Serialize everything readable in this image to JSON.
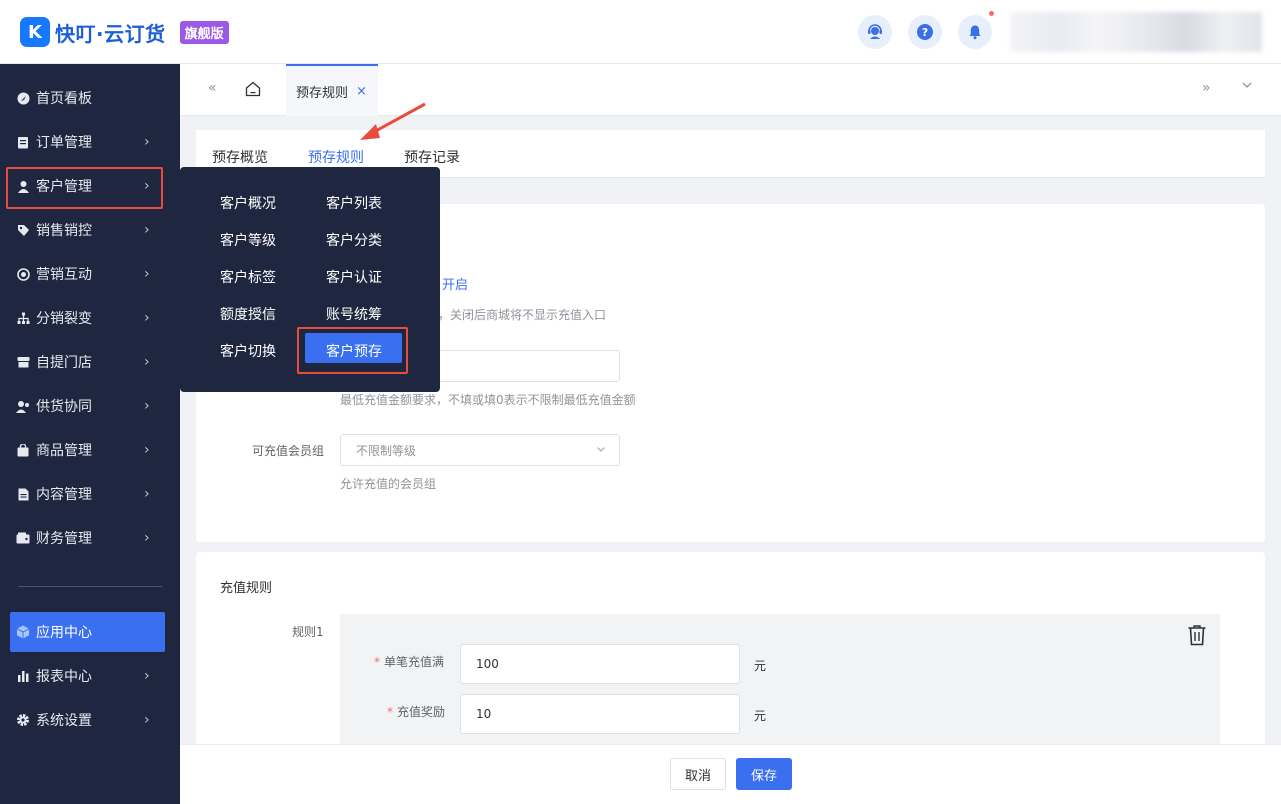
{
  "header": {
    "logo_mark": "K",
    "app_title": "快叮·云订货",
    "edition_badge": "旗舰版",
    "icons": [
      "support-icon",
      "help-icon",
      "bell-icon"
    ],
    "help_glyph": "?"
  },
  "sidebar": {
    "items": [
      {
        "label": "首页看板",
        "icon": "dashboard-icon"
      },
      {
        "label": "订单管理",
        "icon": "order-icon"
      },
      {
        "label": "客户管理",
        "icon": "customer-icon"
      },
      {
        "label": "销售销控",
        "icon": "sales-icon"
      },
      {
        "label": "营销互动",
        "icon": "marketing-icon"
      },
      {
        "label": "分销裂变",
        "icon": "distribution-icon"
      },
      {
        "label": "自提门店",
        "icon": "store-icon"
      },
      {
        "label": "供货协同",
        "icon": "supply-icon"
      },
      {
        "label": "商品管理",
        "icon": "goods-icon"
      },
      {
        "label": "内容管理",
        "icon": "content-icon"
      },
      {
        "label": "财务管理",
        "icon": "finance-icon"
      },
      {
        "label": "应用中心",
        "icon": "app-center-icon"
      },
      {
        "label": "报表中心",
        "icon": "report-icon"
      },
      {
        "label": "系统设置",
        "icon": "settings-icon"
      }
    ]
  },
  "popup_menu": {
    "items": [
      {
        "label": "客户概况"
      },
      {
        "label": "客户列表"
      },
      {
        "label": "客户等级"
      },
      {
        "label": "客户分类"
      },
      {
        "label": "客户标签"
      },
      {
        "label": "客户认证"
      },
      {
        "label": "额度授信"
      },
      {
        "label": "账号统筹"
      },
      {
        "label": "客户切换"
      },
      {
        "label": "客户预存"
      }
    ],
    "active": "客户预存"
  },
  "tabbar": {
    "collapse_glyph": "«",
    "expand_glyph": "»",
    "dropdown_glyph": "⌄",
    "active_tab": "预存规则",
    "close_glyph": "×"
  },
  "subtabs": [
    "预存概览",
    "预存规则",
    "预存记录"
  ],
  "form": {
    "toggle_link": "开启",
    "toggle_hint": "能，关闭后商城将不显示充值入口",
    "min_hint": "最低充值金额要求，不填或填0表示不限制最低充值金额",
    "member_group_label": "可充值会员组",
    "member_group_placeholder": "不限制等级",
    "member_group_hint": "允许充值的会员组"
  },
  "rules": {
    "section_title": "充值规则",
    "rule_label": "规则1",
    "single_label": "单笔充值满",
    "single_value": "100",
    "reward_label": "充值奖励",
    "reward_value": "10",
    "unit": "元",
    "required_mark": "*"
  },
  "footer": {
    "cancel": "取消",
    "save": "保存"
  },
  "colors": {
    "accent": "#3a6ff0",
    "sidebar_bg": "#1f2740",
    "highlight": "#e74c3c"
  }
}
